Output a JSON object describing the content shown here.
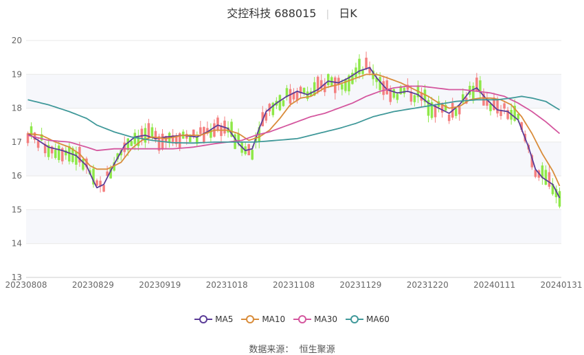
{
  "header": {
    "title": "交控科技 688015",
    "period": "日K"
  },
  "source": {
    "label": "数据来源：",
    "name": "恒生聚源"
  },
  "colors": {
    "up": "#f47f7f",
    "down": "#8ee848",
    "ma5": "#5a3b97",
    "ma10": "#d98c3a",
    "ma30": "#d4569e",
    "ma60": "#3f9899",
    "grid": "#e8e8e8",
    "band": "#f6f7fb"
  },
  "chart_data": {
    "type": "candlestick",
    "title": "交控科技 688015 日K",
    "ylim": [
      13,
      20
    ],
    "yticks": [
      "13",
      "14",
      "15",
      "16",
      "17",
      "18",
      "19",
      "20"
    ],
    "x_ticks": [
      "20230808",
      "20230829",
      "20230919",
      "20231018",
      "20231108",
      "20231129",
      "20231220",
      "20240111",
      "20240131"
    ],
    "legend": [
      "MA5",
      "MA10",
      "MA30",
      "MA60"
    ],
    "series": [
      {
        "name": "MA5",
        "points": [
          [
            0,
            17.25
          ],
          [
            3,
            17.05
          ],
          [
            6,
            16.85
          ],
          [
            10,
            16.75
          ],
          [
            14,
            16.6
          ],
          [
            17,
            16.3
          ],
          [
            19,
            15.85
          ],
          [
            20,
            15.65
          ],
          [
            22,
            15.75
          ],
          [
            25,
            16.35
          ],
          [
            28,
            16.9
          ],
          [
            31,
            17.15
          ],
          [
            34,
            17.2
          ],
          [
            37,
            17.1
          ],
          [
            40,
            17.15
          ],
          [
            45,
            17.2
          ],
          [
            49,
            17.15
          ],
          [
            52,
            17.3
          ],
          [
            55,
            17.5
          ],
          [
            58,
            17.4
          ],
          [
            61,
            16.95
          ],
          [
            63,
            16.75
          ],
          [
            65,
            16.8
          ],
          [
            67,
            17.4
          ],
          [
            69,
            17.9
          ],
          [
            72,
            18.15
          ],
          [
            75,
            18.35
          ],
          [
            78,
            18.5
          ],
          [
            81,
            18.4
          ],
          [
            84,
            18.55
          ],
          [
            87,
            18.8
          ],
          [
            90,
            18.75
          ],
          [
            93,
            18.9
          ],
          [
            96,
            19.1
          ],
          [
            99,
            19.2
          ],
          [
            101,
            18.9
          ],
          [
            104,
            18.55
          ],
          [
            107,
            18.45
          ],
          [
            110,
            18.5
          ],
          [
            113,
            18.4
          ],
          [
            116,
            18.15
          ],
          [
            119,
            18.0
          ],
          [
            122,
            17.85
          ],
          [
            125,
            18.1
          ],
          [
            128,
            18.5
          ],
          [
            130,
            18.6
          ],
          [
            133,
            18.25
          ],
          [
            136,
            17.95
          ],
          [
            139,
            17.9
          ],
          [
            142,
            17.65
          ],
          [
            145,
            16.85
          ],
          [
            147,
            16.2
          ],
          [
            149,
            15.95
          ],
          [
            152,
            15.75
          ],
          [
            154,
            15.35
          ]
        ]
      },
      {
        "name": "MA10",
        "points": [
          [
            0,
            17.25
          ],
          [
            4,
            17.2
          ],
          [
            8,
            17.0
          ],
          [
            12,
            16.85
          ],
          [
            15,
            16.65
          ],
          [
            18,
            16.3
          ],
          [
            20,
            16.2
          ],
          [
            23,
            16.2
          ],
          [
            27,
            16.4
          ],
          [
            30,
            16.8
          ],
          [
            33,
            17.05
          ],
          [
            36,
            17.15
          ],
          [
            40,
            17.1
          ],
          [
            45,
            17.2
          ],
          [
            50,
            17.2
          ],
          [
            54,
            17.35
          ],
          [
            58,
            17.35
          ],
          [
            61,
            17.25
          ],
          [
            64,
            17.05
          ],
          [
            67,
            17.15
          ],
          [
            70,
            17.35
          ],
          [
            73,
            17.7
          ],
          [
            76,
            18.1
          ],
          [
            79,
            18.3
          ],
          [
            82,
            18.35
          ],
          [
            86,
            18.6
          ],
          [
            90,
            18.7
          ],
          [
            94,
            18.85
          ],
          [
            98,
            19.0
          ],
          [
            101,
            19.0
          ],
          [
            104,
            18.9
          ],
          [
            108,
            18.75
          ],
          [
            112,
            18.55
          ],
          [
            116,
            18.35
          ],
          [
            119,
            18.15
          ],
          [
            122,
            18.0
          ],
          [
            125,
            18.05
          ],
          [
            128,
            18.25
          ],
          [
            131,
            18.3
          ],
          [
            134,
            18.3
          ],
          [
            137,
            18.25
          ],
          [
            140,
            18.1
          ],
          [
            143,
            17.75
          ],
          [
            146,
            17.25
          ],
          [
            149,
            16.65
          ],
          [
            152,
            16.15
          ],
          [
            154,
            15.7
          ]
        ]
      },
      {
        "name": "MA30",
        "points": [
          [
            0,
            17.2
          ],
          [
            6,
            17.05
          ],
          [
            12,
            17.0
          ],
          [
            17,
            16.85
          ],
          [
            20,
            16.75
          ],
          [
            25,
            16.8
          ],
          [
            30,
            16.8
          ],
          [
            36,
            16.8
          ],
          [
            42,
            16.8
          ],
          [
            48,
            16.85
          ],
          [
            54,
            16.95
          ],
          [
            58,
            17.0
          ],
          [
            62,
            17.05
          ],
          [
            66,
            17.2
          ],
          [
            70,
            17.3
          ],
          [
            74,
            17.45
          ],
          [
            78,
            17.6
          ],
          [
            82,
            17.75
          ],
          [
            86,
            17.85
          ],
          [
            90,
            18.0
          ],
          [
            94,
            18.15
          ],
          [
            98,
            18.35
          ],
          [
            102,
            18.5
          ],
          [
            106,
            18.6
          ],
          [
            110,
            18.65
          ],
          [
            114,
            18.65
          ],
          [
            118,
            18.6
          ],
          [
            122,
            18.55
          ],
          [
            126,
            18.55
          ],
          [
            130,
            18.5
          ],
          [
            134,
            18.45
          ],
          [
            138,
            18.35
          ],
          [
            142,
            18.15
          ],
          [
            146,
            17.9
          ],
          [
            150,
            17.6
          ],
          [
            154,
            17.25
          ]
        ]
      },
      {
        "name": "MA60",
        "points": [
          [
            0,
            18.25
          ],
          [
            6,
            18.1
          ],
          [
            12,
            17.9
          ],
          [
            17,
            17.7
          ],
          [
            20,
            17.5
          ],
          [
            25,
            17.3
          ],
          [
            30,
            17.15
          ],
          [
            36,
            17.05
          ],
          [
            42,
            16.98
          ],
          [
            48,
            16.97
          ],
          [
            54,
            17.0
          ],
          [
            60,
            17.0
          ],
          [
            66,
            17.0
          ],
          [
            72,
            17.05
          ],
          [
            78,
            17.1
          ],
          [
            84,
            17.25
          ],
          [
            90,
            17.4
          ],
          [
            95,
            17.55
          ],
          [
            100,
            17.75
          ],
          [
            106,
            17.9
          ],
          [
            112,
            18.0
          ],
          [
            118,
            18.1
          ],
          [
            124,
            18.2
          ],
          [
            130,
            18.25
          ],
          [
            136,
            18.25
          ],
          [
            140,
            18.3
          ],
          [
            143,
            18.35
          ],
          [
            146,
            18.3
          ],
          [
            150,
            18.2
          ],
          [
            154,
            17.95
          ]
        ]
      }
    ]
  }
}
